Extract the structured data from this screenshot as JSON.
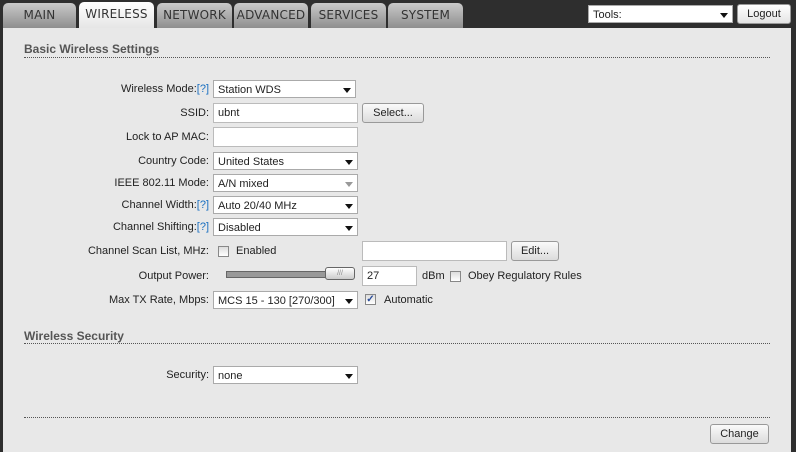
{
  "tabs": [
    "MAIN",
    "WIRELESS",
    "NETWORK",
    "ADVANCED",
    "SERVICES",
    "SYSTEM"
  ],
  "tools": {
    "label": "Tools:",
    "logout": "Logout"
  },
  "basic": {
    "title": "Basic Wireless Settings",
    "help": "[?]",
    "wireless_mode": {
      "label": "Wireless Mode:",
      "value": "Station WDS"
    },
    "ssid": {
      "label": "SSID:",
      "value": "ubnt",
      "button": "Select..."
    },
    "lock_mac": {
      "label": "Lock to AP MAC:",
      "value": ""
    },
    "country": {
      "label": "Country Code:",
      "value": "United States"
    },
    "ieee": {
      "label": "IEEE 802.11 Mode:",
      "value": "A/N mixed"
    },
    "width": {
      "label": "Channel Width:",
      "value": "Auto 20/40 MHz"
    },
    "shifting": {
      "label": "Channel Shifting:",
      "value": "Disabled"
    },
    "scan": {
      "label": "Channel Scan List, MHz:",
      "enabled_label": "Enabled",
      "enabled": false,
      "value": "",
      "button": "Edit..."
    },
    "power": {
      "label": "Output Power:",
      "value": "27",
      "unit": "dBm",
      "slider_fraction": 1.0,
      "obey_label": "Obey Regulatory Rules",
      "obey": false
    },
    "txrate": {
      "label": "Max TX Rate, Mbps:",
      "value": "MCS 15 - 130 [270/300]",
      "auto_label": "Automatic",
      "auto": true
    }
  },
  "security": {
    "title": "Wireless Security",
    "label": "Security:",
    "value": "none"
  },
  "change": "Change"
}
